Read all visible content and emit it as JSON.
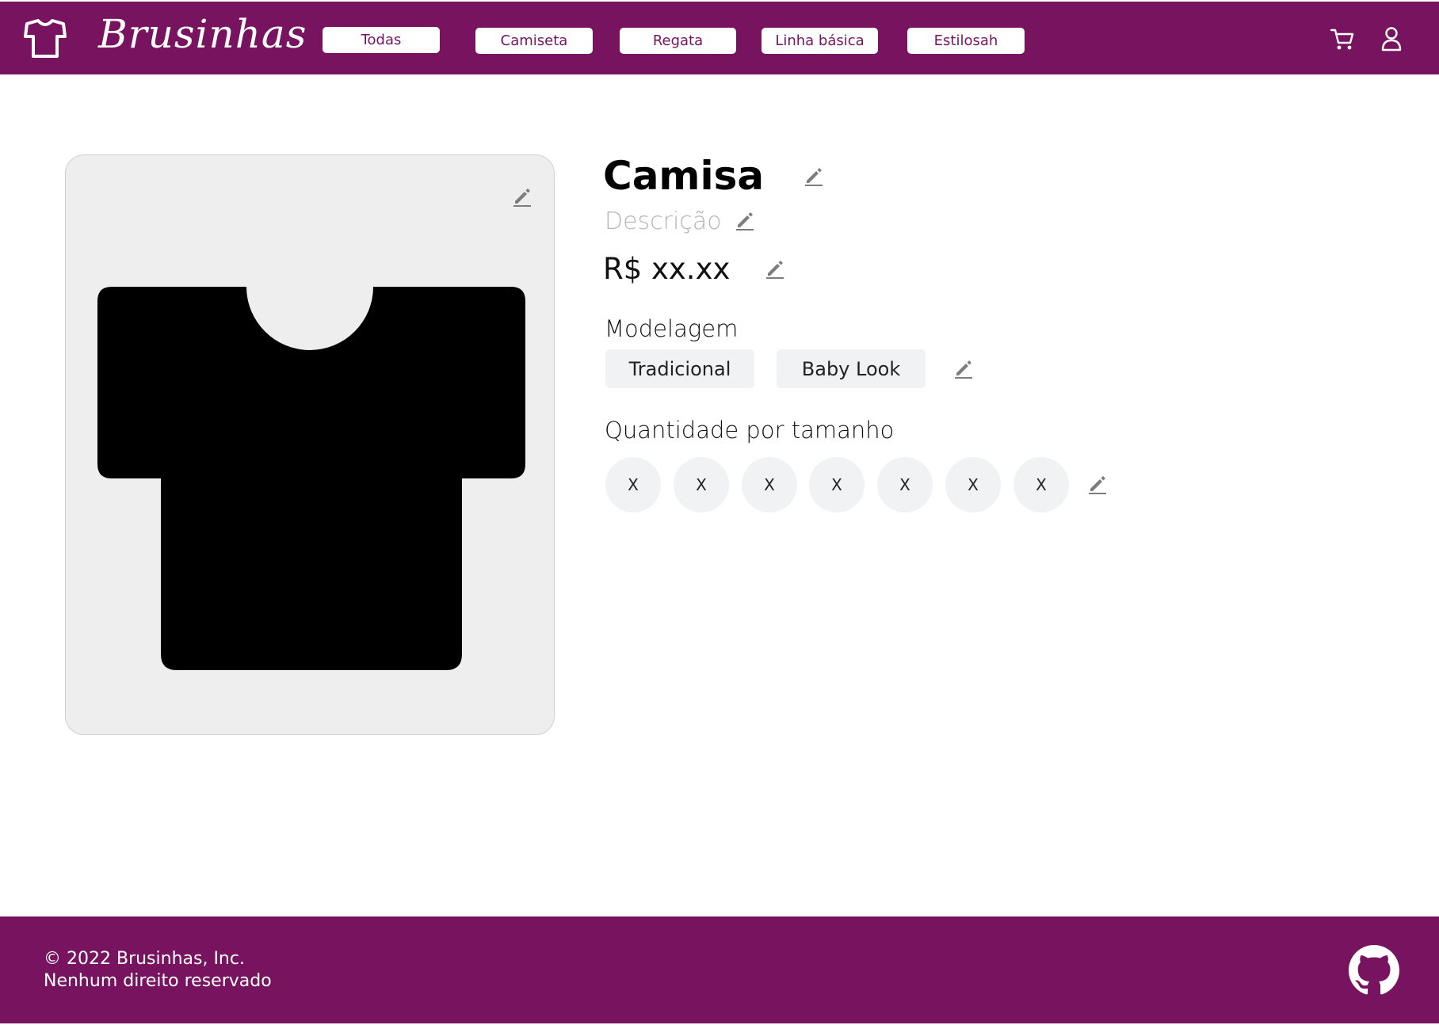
{
  "header": {
    "brand": "Brusinhas",
    "nav": [
      "Todas",
      "Camiseta",
      "Regata",
      "Linha básica",
      "Estilosah"
    ],
    "icons": {
      "logo": "tshirt-icon",
      "cart": "cart-icon",
      "user": "user-icon"
    }
  },
  "product": {
    "title": "Camisa",
    "description": "Descrição",
    "price": "R$ xx.xx",
    "modelagem_label": "Modelagem",
    "modelagem": [
      "Tradicional",
      "Baby Look"
    ],
    "quantidade_label": "Quantidade por tamanho",
    "sizes": [
      "X",
      "X",
      "X",
      "X",
      "X",
      "X",
      "X"
    ]
  },
  "footer": {
    "copyright": "© 2022 Brusinhas, Inc.",
    "rights": "Nenhum direito reservado"
  },
  "colors": {
    "brand": "#77135f",
    "chip": "#f0f2f3",
    "card": "#eeeeee"
  }
}
